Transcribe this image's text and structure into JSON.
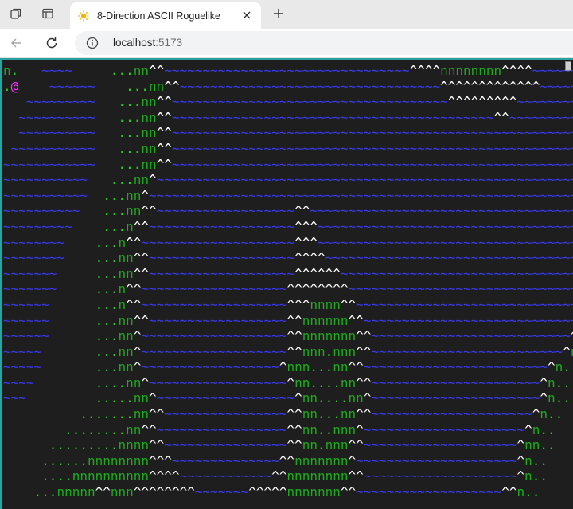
{
  "browser": {
    "tab_title": "8-Direction ASCII Roguelike",
    "url_host": "localhost",
    "url_port": ":5173"
  },
  "icons": {
    "workspaces": "collections-icon",
    "tab_actions": "tab-sidebar-icon",
    "favicon": "sun-icon",
    "close": "close-icon",
    "new_tab": "plus-icon",
    "back": "back-arrow-icon",
    "reload": "reload-icon",
    "site_info": "info-icon"
  },
  "colors": {
    "water": "#3a3af0",
    "floor": "#2bd12b",
    "grass": "#1faa1f",
    "mountain": "#ffffff",
    "player": "#ff33ff",
    "background": "#1e1e1e",
    "frame": "#2aa3a0"
  },
  "legend": {
    "player": "@",
    "floor": ".",
    "grass": "n",
    "mountain": "^",
    "water": "~"
  },
  "map_rows": [
    "n.   ~~~~     ...nn^^~~~~~~~~~~~~~~~~~~~~~~~~~~~~~~~~^^^^nnnnnnnn^^^^~~~~~~^^",
    ".@    ~~~~~~    ...nn^^~~~~~~~~~~~~~~~~~~~~~~~~~~~~~~~~~~^^^^^^^^^^^^^~~~~~~~^",
    "   ~~~~~~~~~   ...nn^^~~~~~~~~~~~~~~~~~~~~~~~~~~~~~~~~~~~~^^^^^^^^^~~~~~~~~~~~",
    "  ~~~~~~~~~~   ...nn^^~~~~~~~~~~~~~~~~~~~~~~~~~~~~~~~~~~~~~~~~~~^^~~~~~~~~~~~~",
    "  ~~~~~~~~~~   ...nn^^~~~~~~~~~~~~~~~~~~~~~~~~~~~~~~~~~~~~~~~~~~~~~~~~~~~~~~~~",
    " ~~~~~~~~~~~   ...nn^^~~~~~~~~~~~~~~~~~~~~~~~~~~~~~~~~~~~~~~~~~~~~~~~~~~~~~~~~",
    "~~~~~~~~~~~~   ...nn^^~~~~~~~~~~~~~~~~~~~~~~~~~~~~~~~~~~~~~~~~~~~~~~~~~~~~~~~~",
    "~~~~~~~~~~~   ...nn^~~~~~~~~~~~~~~~~~~~~~~~~~~~~~~~~~~~~~~~~~~~~~~~~~~~~~~~~~^",
    "~~~~~~~~~~~  ...nn^~~~~~~~~~~~~~~~~~~~~~~~~~~~~~~~~~~~~~~~~~~~~~~~~~~~~~~~~~~^",
    "~~~~~~~~~~   ...nn^^~~~~~~~~~~~~~~~~~~^^~~~~~~~~~~~~~~~~~~~~~~~~~~~~~~~~~~~~~~^",
    "~~~~~~~~~    ...n^^~~~~~~~~~~~~~~~~~~~^^^~~~~~~~~~~~~~~~~~~~~~~~~~~~~~~~~~~~~~^^",
    "~~~~~~~~    ...n^^~~~~~~~~~~~~~~~~~~~~^^^~~~~~~~~~~~~~~~~~~~~~~~~~~~~~~~~~~~~~^^",
    "~~~~~~~~    ...nn^^~~~~~~~~~~~~~~~~~~~^^^^~~~~~~~~~~~~~~~~~~~~~~~~~~~~~~~~~~~~^",
    "~~~~~~~     ...nn^^~~~~~~~~~~~~~~~~~~~^^^^^^~~~~~~~~~~~~~~~~~~~~~~~~~~~~~~~~~^",
    "~~~~~~~     ...n^^~~~~~~~~~~~~~~~~~~~^^^^^^^^~~~~~~~~~~~~~~~~~~~~~~~~~~~~~~~^",
    "~~~~~~      ...n^^~~~~~~~~~~~~~~~~~~~^^^nnnn^^~~~~~~~~~~~~~~~~~~~~~~~~~~~~~~n.",
    "~~~~~~      ...nn^^~~~~~~~~~~~~~~~~~~^^nnnnnn^^~~~~~~~~~~~~~~~~~~~~~~~~~~~~^.",
    "~~~~~~      ...nn^~~~~~~~~~~~~~~~~~~~^^nnnnnnn^^~~~~~~~~~~~~~~~~~~~~~~~~~~^.",
    "~~~~~       ...nn^~~~~~~~~~~~~~~~~~~~^^nnn.nnn^^~~~~~~~~~~~~~~~~~~~~~~~~~^n..",
    "~~~~~       ...nn^~~~~~~~~~~~~~~~~~~^nnn...nn^^~~~~~~~~~~~~~~~~~~~~~~~~^n..",
    "~~~~        ....nn^~~~~~~~~~~~~~~~~~~^nn....nn^^~~~~~~~~~~~~~~~~~~~~~~^n..",
    "~~~         .....nn^~~~~~~~~~~~~~~~~~~^nn....nn^~~~~~~~~~~~~~~~~~~~~~~^n..",
    "          .......nn^^~~~~~~~~~~~~~~~~^^nn...nn^^~~~~~~~~~~~~~~~~~~~~~^n..",
    "        ........nn^^~~~~~~~~~~~~~~~~~^^nn..nnn^~~~~~~~~~~~~~~~~~~~~~^n..",
    "      .........nnnn^^~~~~~~~~~~~~~~~~^^nn.nnn^^~~~~~~~~~~~~~~~~~~~~^nn..",
    "     ......nnnnnnnn^^^~~~~~~~~~~~~~~^^nnnnnnn^~~~~~~~~~~~~~~~~~~~~~^n..",
    "     ....nnnnnnnnnn^^^^~~~~~~~~~~~~^^nnnnnnnn^^~~~~~~~~~~~~~~~~~~~~^n..",
    "    ...nnnnn^^nnn^^^^^^^^~~~~~~~^^^^^nnnnnnn^^~~~~~~~~~~~~~~~~~~~^^n.."
  ]
}
